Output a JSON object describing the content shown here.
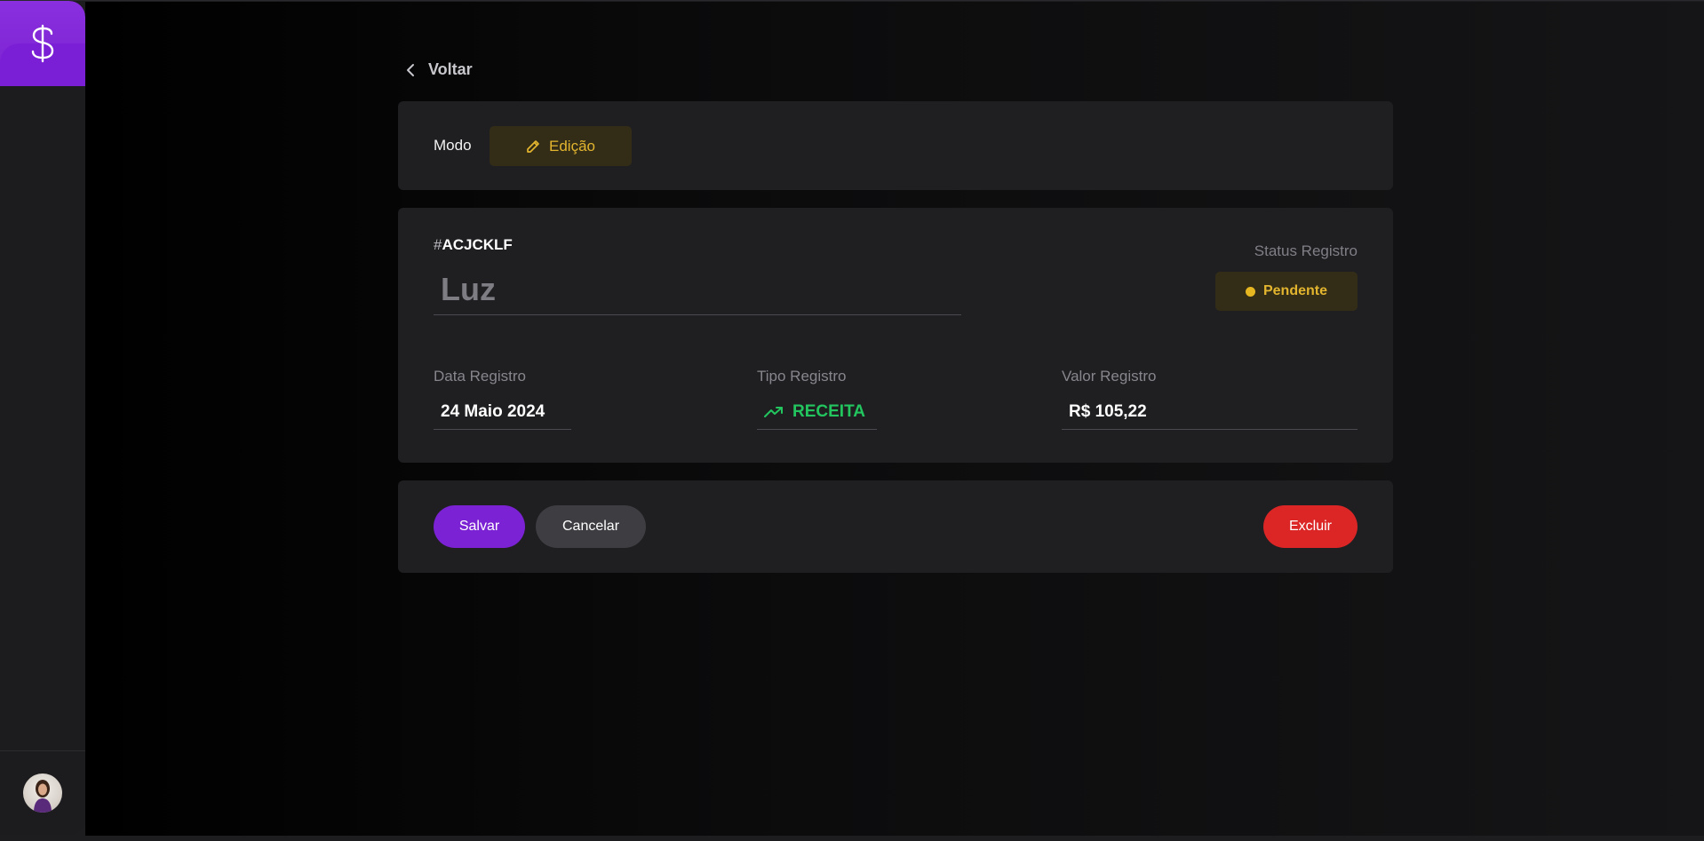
{
  "sidebar": {
    "logo_icon": "dollar-sign-icon",
    "avatar_icon": "user-avatar"
  },
  "nav": {
    "back_label": "Voltar",
    "back_icon": "chevron-left-icon"
  },
  "mode": {
    "label": "Modo",
    "badge": "Edição",
    "badge_icon": "pencil-icon"
  },
  "record": {
    "hash": "#",
    "id": "ACJCKLF",
    "name": "Luz",
    "status_label": "Status Registro",
    "status": "Pendente",
    "date_label": "Data Registro",
    "date": "24 Maio 2024",
    "type_label": "Tipo Registro",
    "type": "RECEITA",
    "type_icon": "trending-up-icon",
    "value_label": "Valor Registro",
    "value": "R$ 105,22"
  },
  "actions": {
    "save": "Salvar",
    "cancel": "Cancelar",
    "delete": "Excluir"
  },
  "colors": {
    "accent": "#7b22d4",
    "pending": "#e3b52e",
    "income": "#22c55e",
    "danger": "#dc2626"
  }
}
